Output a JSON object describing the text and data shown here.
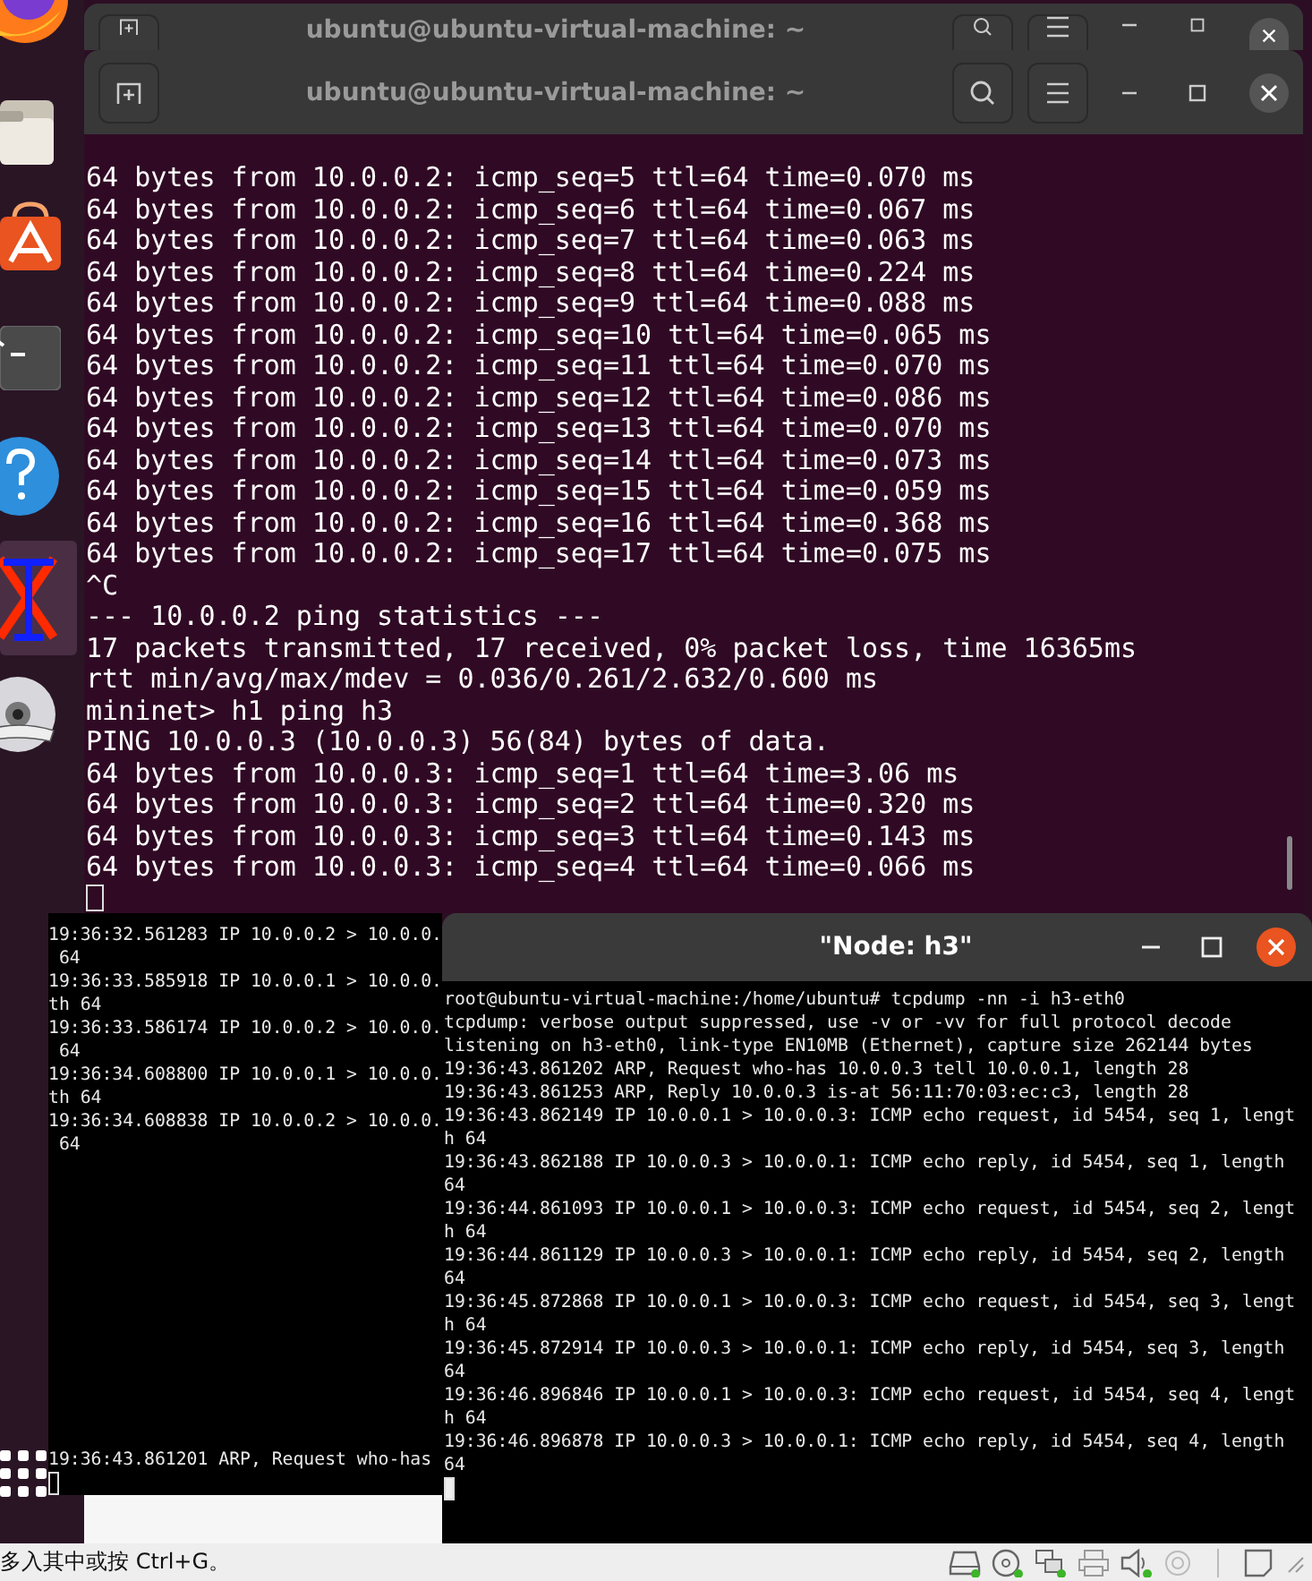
{
  "back_terminal": {
    "title": "ubuntu@ubuntu-virtual-machine: ~"
  },
  "front_terminal": {
    "title": "ubuntu@ubuntu-virtual-machine: ~",
    "focused": false,
    "lines": [
      "64 bytes from 10.0.0.2: icmp_seq=5 ttl=64 time=0.070 ms",
      "64 bytes from 10.0.0.2: icmp_seq=6 ttl=64 time=0.067 ms",
      "64 bytes from 10.0.0.2: icmp_seq=7 ttl=64 time=0.063 ms",
      "64 bytes from 10.0.0.2: icmp_seq=8 ttl=64 time=0.224 ms",
      "64 bytes from 10.0.0.2: icmp_seq=9 ttl=64 time=0.088 ms",
      "64 bytes from 10.0.0.2: icmp_seq=10 ttl=64 time=0.065 ms",
      "64 bytes from 10.0.0.2: icmp_seq=11 ttl=64 time=0.070 ms",
      "64 bytes from 10.0.0.2: icmp_seq=12 ttl=64 time=0.086 ms",
      "64 bytes from 10.0.0.2: icmp_seq=13 ttl=64 time=0.070 ms",
      "64 bytes from 10.0.0.2: icmp_seq=14 ttl=64 time=0.073 ms",
      "64 bytes from 10.0.0.2: icmp_seq=15 ttl=64 time=0.059 ms",
      "64 bytes from 10.0.0.2: icmp_seq=16 ttl=64 time=0.368 ms",
      "64 bytes from 10.0.0.2: icmp_seq=17 ttl=64 time=0.075 ms",
      "^C",
      "--- 10.0.0.2 ping statistics ---",
      "17 packets transmitted, 17 received, 0% packet loss, time 16365ms",
      "rtt min/avg/max/mdev = 0.036/0.261/2.632/0.600 ms",
      "mininet> h1 ping h3",
      "PING 10.0.0.3 (10.0.0.3) 56(84) bytes of data.",
      "64 bytes from 10.0.0.3: icmp_seq=1 ttl=64 time=3.06 ms",
      "64 bytes from 10.0.0.3: icmp_seq=2 ttl=64 time=0.320 ms",
      "64 bytes from 10.0.0.3: icmp_seq=3 ttl=64 time=0.143 ms",
      "64 bytes from 10.0.0.3: icmp_seq=4 ttl=64 time=0.066 ms"
    ]
  },
  "left_xterm": {
    "focused": false,
    "lines": [
      "19:36:32.561283 IP 10.0.0.2 > 10.0.0.",
      " 64",
      "19:36:33.585918 IP 10.0.0.1 > 10.0.0.",
      "th 64",
      "19:36:33.586174 IP 10.0.0.2 > 10.0.0.",
      " 64",
      "19:36:34.608800 IP 10.0.0.1 > 10.0.0.",
      "th 64",
      "19:36:34.608838 IP 10.0.0.2 > 10.0.0.",
      " 64"
    ],
    "last_line": "19:36:43.861201 ARP, Request who-has"
  },
  "h3_xterm": {
    "title": "\"Node: h3\"",
    "focused": true,
    "lines": [
      "root@ubuntu-virtual-machine:/home/ubuntu# tcpdump -nn -i h3-eth0",
      "tcpdump: verbose output suppressed, use -v or -vv for full protocol decode",
      "listening on h3-eth0, link-type EN10MB (Ethernet), capture size 262144 bytes",
      "19:36:43.861202 ARP, Request who-has 10.0.0.3 tell 10.0.0.1, length 28",
      "19:36:43.861253 ARP, Reply 10.0.0.3 is-at 56:11:70:03:ec:c3, length 28",
      "19:36:43.862149 IP 10.0.0.1 > 10.0.0.3: ICMP echo request, id 5454, seq 1, lengt",
      "h 64",
      "19:36:43.862188 IP 10.0.0.3 > 10.0.0.1: ICMP echo reply, id 5454, seq 1, length",
      "64",
      "19:36:44.861093 IP 10.0.0.1 > 10.0.0.3: ICMP echo request, id 5454, seq 2, lengt",
      "h 64",
      "19:36:44.861129 IP 10.0.0.3 > 10.0.0.1: ICMP echo reply, id 5454, seq 2, length",
      "64",
      "19:36:45.872868 IP 10.0.0.1 > 10.0.0.3: ICMP echo request, id 5454, seq 3, lengt",
      "h 64",
      "19:36:45.872914 IP 10.0.0.3 > 10.0.0.1: ICMP echo reply, id 5454, seq 3, length",
      "64",
      "19:36:46.896846 IP 10.0.0.1 > 10.0.0.3: ICMP echo request, id 5454, seq 4, lengt",
      "h 64",
      "19:36:46.896878 IP 10.0.0.3 > 10.0.0.1: ICMP echo reply, id 5454, seq 4, length",
      "64"
    ]
  },
  "status_bar": {
    "text": "多入其中或按 Ctrl+G。"
  }
}
